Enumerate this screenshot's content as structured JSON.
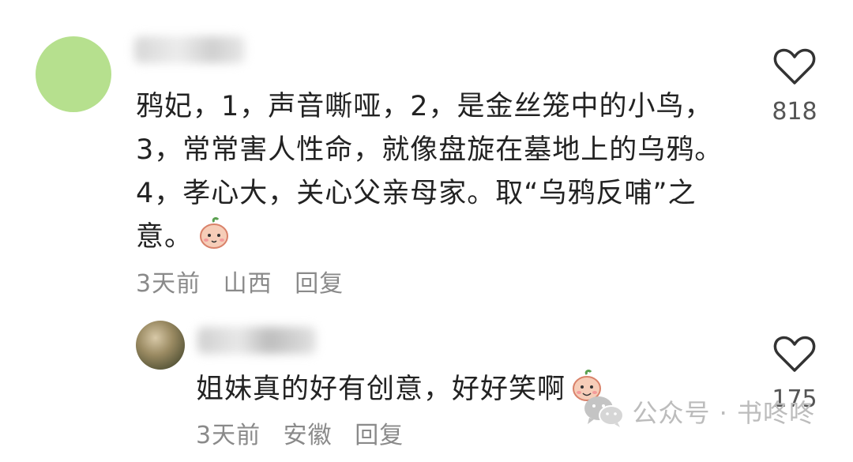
{
  "comments": [
    {
      "text": "鸦妃，1，声音嘶哑，2，是金丝笼中的小鸟，3，常常害人性命，就像盘旋在墓地上的乌鸦。4，孝心大，关心父亲母家。取“乌鸦反哺”之意。",
      "time": "3天前",
      "location": "山西",
      "reply_label": "回复",
      "likes": "818"
    },
    {
      "text": "姐妹真的好有创意，好好笑啊",
      "time": "3天前",
      "location": "安徽",
      "reply_label": "回复",
      "likes": "175"
    }
  ],
  "watermark": {
    "text": "公众号 · 书咚咚",
    "icon": "wechat-icon"
  },
  "colors": {
    "avatar_main": "#b6e08e",
    "meta_text": "#8a8a8a",
    "body_text": "#222222"
  }
}
